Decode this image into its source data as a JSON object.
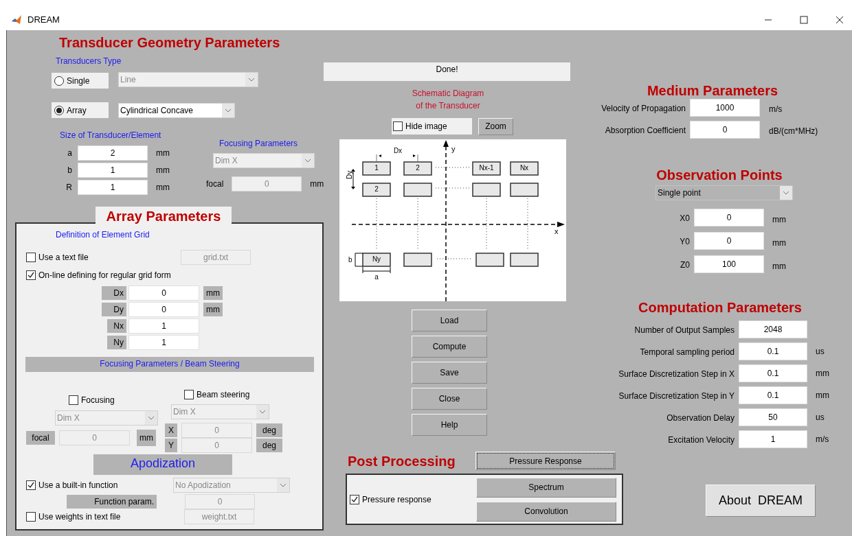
{
  "window": {
    "title": "DREAM"
  },
  "transducer_geometry": {
    "title": "Transducer Geometry Parameters",
    "type_label": "Transducers Type",
    "types": [
      {
        "label": "Single",
        "selected": false,
        "shape": "Line"
      },
      {
        "label": "Array",
        "selected": true,
        "shape": "Cylindrical Concave"
      }
    ],
    "size": {
      "title": "Size of Transducer/Element",
      "fields": [
        {
          "label": "a",
          "value": "2",
          "unit": "mm"
        },
        {
          "label": "b",
          "value": "1",
          "unit": "mm"
        },
        {
          "label": "R",
          "value": "1",
          "unit": "mm"
        }
      ]
    },
    "focusing": {
      "title": "Focusing Parameters",
      "disabled": true,
      "dim": "Dim X",
      "focal_label": "focal",
      "focal": "0",
      "unit": "mm"
    }
  },
  "array": {
    "title": "Array Parameters",
    "grid_title": "Definition of Element Grid",
    "use_text_file": {
      "label": "Use a text file",
      "checked": false,
      "file": "grid.txt"
    },
    "online": {
      "label": "On-line defining for regular grid form",
      "checked": true
    },
    "grid_fields": [
      {
        "label": "Dx",
        "value": "0",
        "unit": "mm"
      },
      {
        "label": "Dy",
        "value": "0",
        "unit": "mm"
      },
      {
        "label": "Nx",
        "value": "1"
      },
      {
        "label": "Ny",
        "value": "1"
      }
    ],
    "steering_title": "Focusing Parameters / Beam Steering",
    "focusing": {
      "label": "Focusing",
      "checked": false,
      "dim": "Dim X",
      "focal_label": "focal",
      "focal": "0",
      "unit": "mm"
    },
    "beam_steering": {
      "label": "Beam steering",
      "checked": false,
      "dim": "Dim X",
      "angles": [
        {
          "label": "X",
          "value": "0",
          "unit": "deg"
        },
        {
          "label": "Y",
          "value": "0",
          "unit": "deg"
        }
      ]
    },
    "apodization": {
      "title": "Apodization",
      "builtin": {
        "label": "Use a built-in function",
        "checked": true
      },
      "function": {
        "value": "No Apodization",
        "disabled": true
      },
      "param_label": "Function param.",
      "param": {
        "value": "0",
        "disabled": true
      },
      "weights": {
        "label": "Use weights in text file",
        "checked": false,
        "file": "weight.txt"
      }
    }
  },
  "status": "Done!",
  "schematic": {
    "title_lines": [
      "Schematic Diagram",
      "of the Transducer"
    ],
    "hide_image": {
      "label": "Hide image",
      "checked": false
    },
    "zoom_button": "Zoom",
    "diagram": {
      "dx": "Dx",
      "dy": "Dy",
      "a": "a",
      "b": "b",
      "x_axis": "x",
      "y_axis": "y",
      "first_row": [
        "1",
        "2",
        "Nx-1",
        "Nx"
      ],
      "first_column": [
        "2",
        "Ny"
      ]
    }
  },
  "actions": [
    "Load",
    "Compute",
    "Save",
    "Close",
    "Help"
  ],
  "medium": {
    "title": "Medium Parameters",
    "fields": [
      {
        "label": "Velocity of Propagation",
        "value": "1000",
        "unit": "m/s"
      },
      {
        "label": "Absorption Coefficient",
        "value": "0",
        "unit": "dB/(cm*MHz)"
      }
    ]
  },
  "observation": {
    "title": "Observation Points",
    "mode": "Single point",
    "fields": [
      {
        "label": "X0",
        "value": "0",
        "unit": "mm"
      },
      {
        "label": "Y0",
        "value": "0",
        "unit": "mm"
      },
      {
        "label": "Z0",
        "value": "100",
        "unit": "mm"
      }
    ]
  },
  "computation": {
    "title": "Computation Parameters",
    "fields": [
      {
        "label": "Number of Output Samples",
        "value": "2048"
      },
      {
        "label": "Temporal sampling period",
        "value": "0.1",
        "unit": "us"
      },
      {
        "label": "Surface Discretization Step in X",
        "value": "0.1",
        "unit": "mm"
      },
      {
        "label": "Surface Discretization Step in Y",
        "value": "0.1",
        "unit": "mm"
      },
      {
        "label": "Observation Delay",
        "value": "50",
        "unit": "us"
      },
      {
        "label": "Excitation Velocity",
        "value": "1",
        "unit": "m/s"
      }
    ]
  },
  "post_processing": {
    "title": "Post Processing",
    "pressure_button": "Pressure Response",
    "pressure_checkbox": {
      "label": "Pressure response",
      "checked": true
    },
    "buttons": [
      "Spectrum",
      "Convolution"
    ]
  },
  "about_button": "About  DREAM"
}
